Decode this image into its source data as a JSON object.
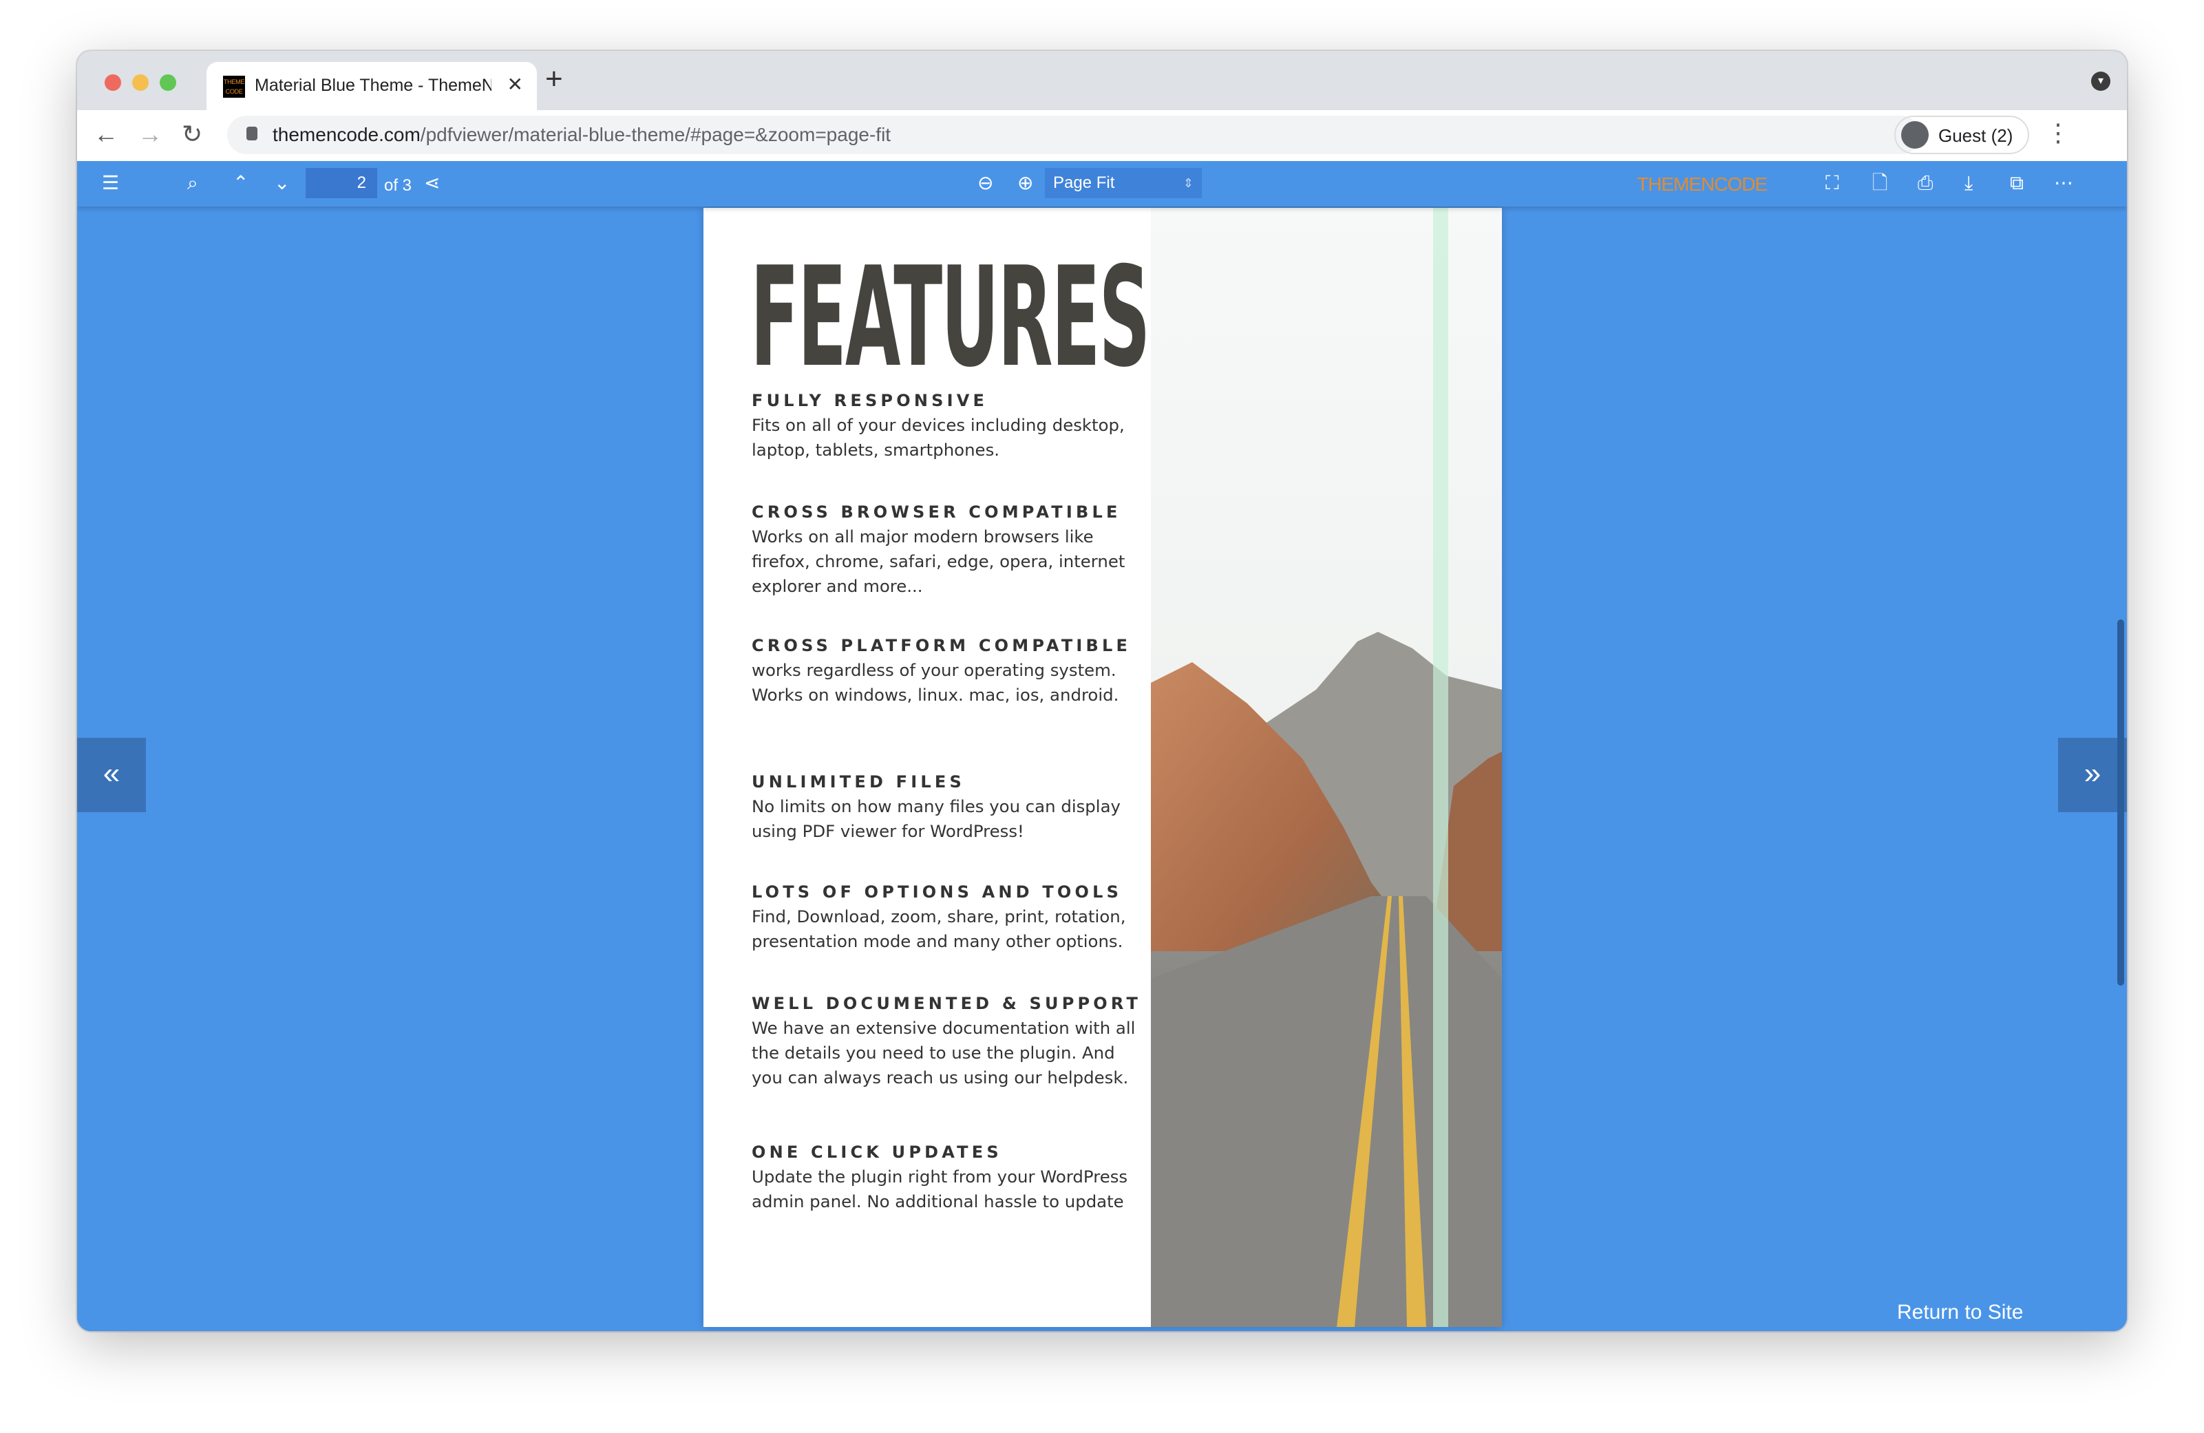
{
  "browser": {
    "tab_title": "Material Blue Theme - ThemeNcode",
    "favicon_text": "THEME CODE",
    "url_domain": "themencode.com",
    "url_path": "/pdfviewer/material-blue-theme/#page=&zoom=page-fit",
    "profile_label": "Guest (2)"
  },
  "viewer": {
    "current_page": "2",
    "page_count_label": "of 3",
    "zoom_value": "Page Fit",
    "logo_text": "THEMENCODE",
    "return_label": "Return to Site",
    "accent_color": "#4a94e8",
    "logo_color": "#e38c2c"
  },
  "document": {
    "title": "FEATURES",
    "sections": [
      {
        "heading": "FULLY RESPONSIVE",
        "body": "Fits on all of your devices including desktop, laptop, tablets, smartphones."
      },
      {
        "heading": "CROSS BROWSER COMPATIBLE",
        "body": "Works on all major modern browsers like firefox, chrome, safari, edge, opera, internet explorer and more..."
      },
      {
        "heading": "CROSS PLATFORM COMPATIBLE",
        "body": "works regardless of your operating system. Works on windows, linux. mac, ios, android."
      },
      {
        "heading": "UNLIMITED FILES",
        "body": "No limits on how many files you can display using PDF viewer for WordPress!"
      },
      {
        "heading": "LOTS OF OPTIONS AND TOOLS",
        "body": "Find, Download, zoom, share, print, rotation, presentation mode and many other options."
      },
      {
        "heading": "WELL DOCUMENTED & SUPPORT",
        "body": "We have an extensive documentation with all the details you need to use the plugin. And you can always reach us using our helpdesk."
      },
      {
        "heading": "ONE CLICK UPDATES",
        "body": "Update the plugin right from your WordPress admin panel. No additional hassle to update"
      }
    ]
  }
}
